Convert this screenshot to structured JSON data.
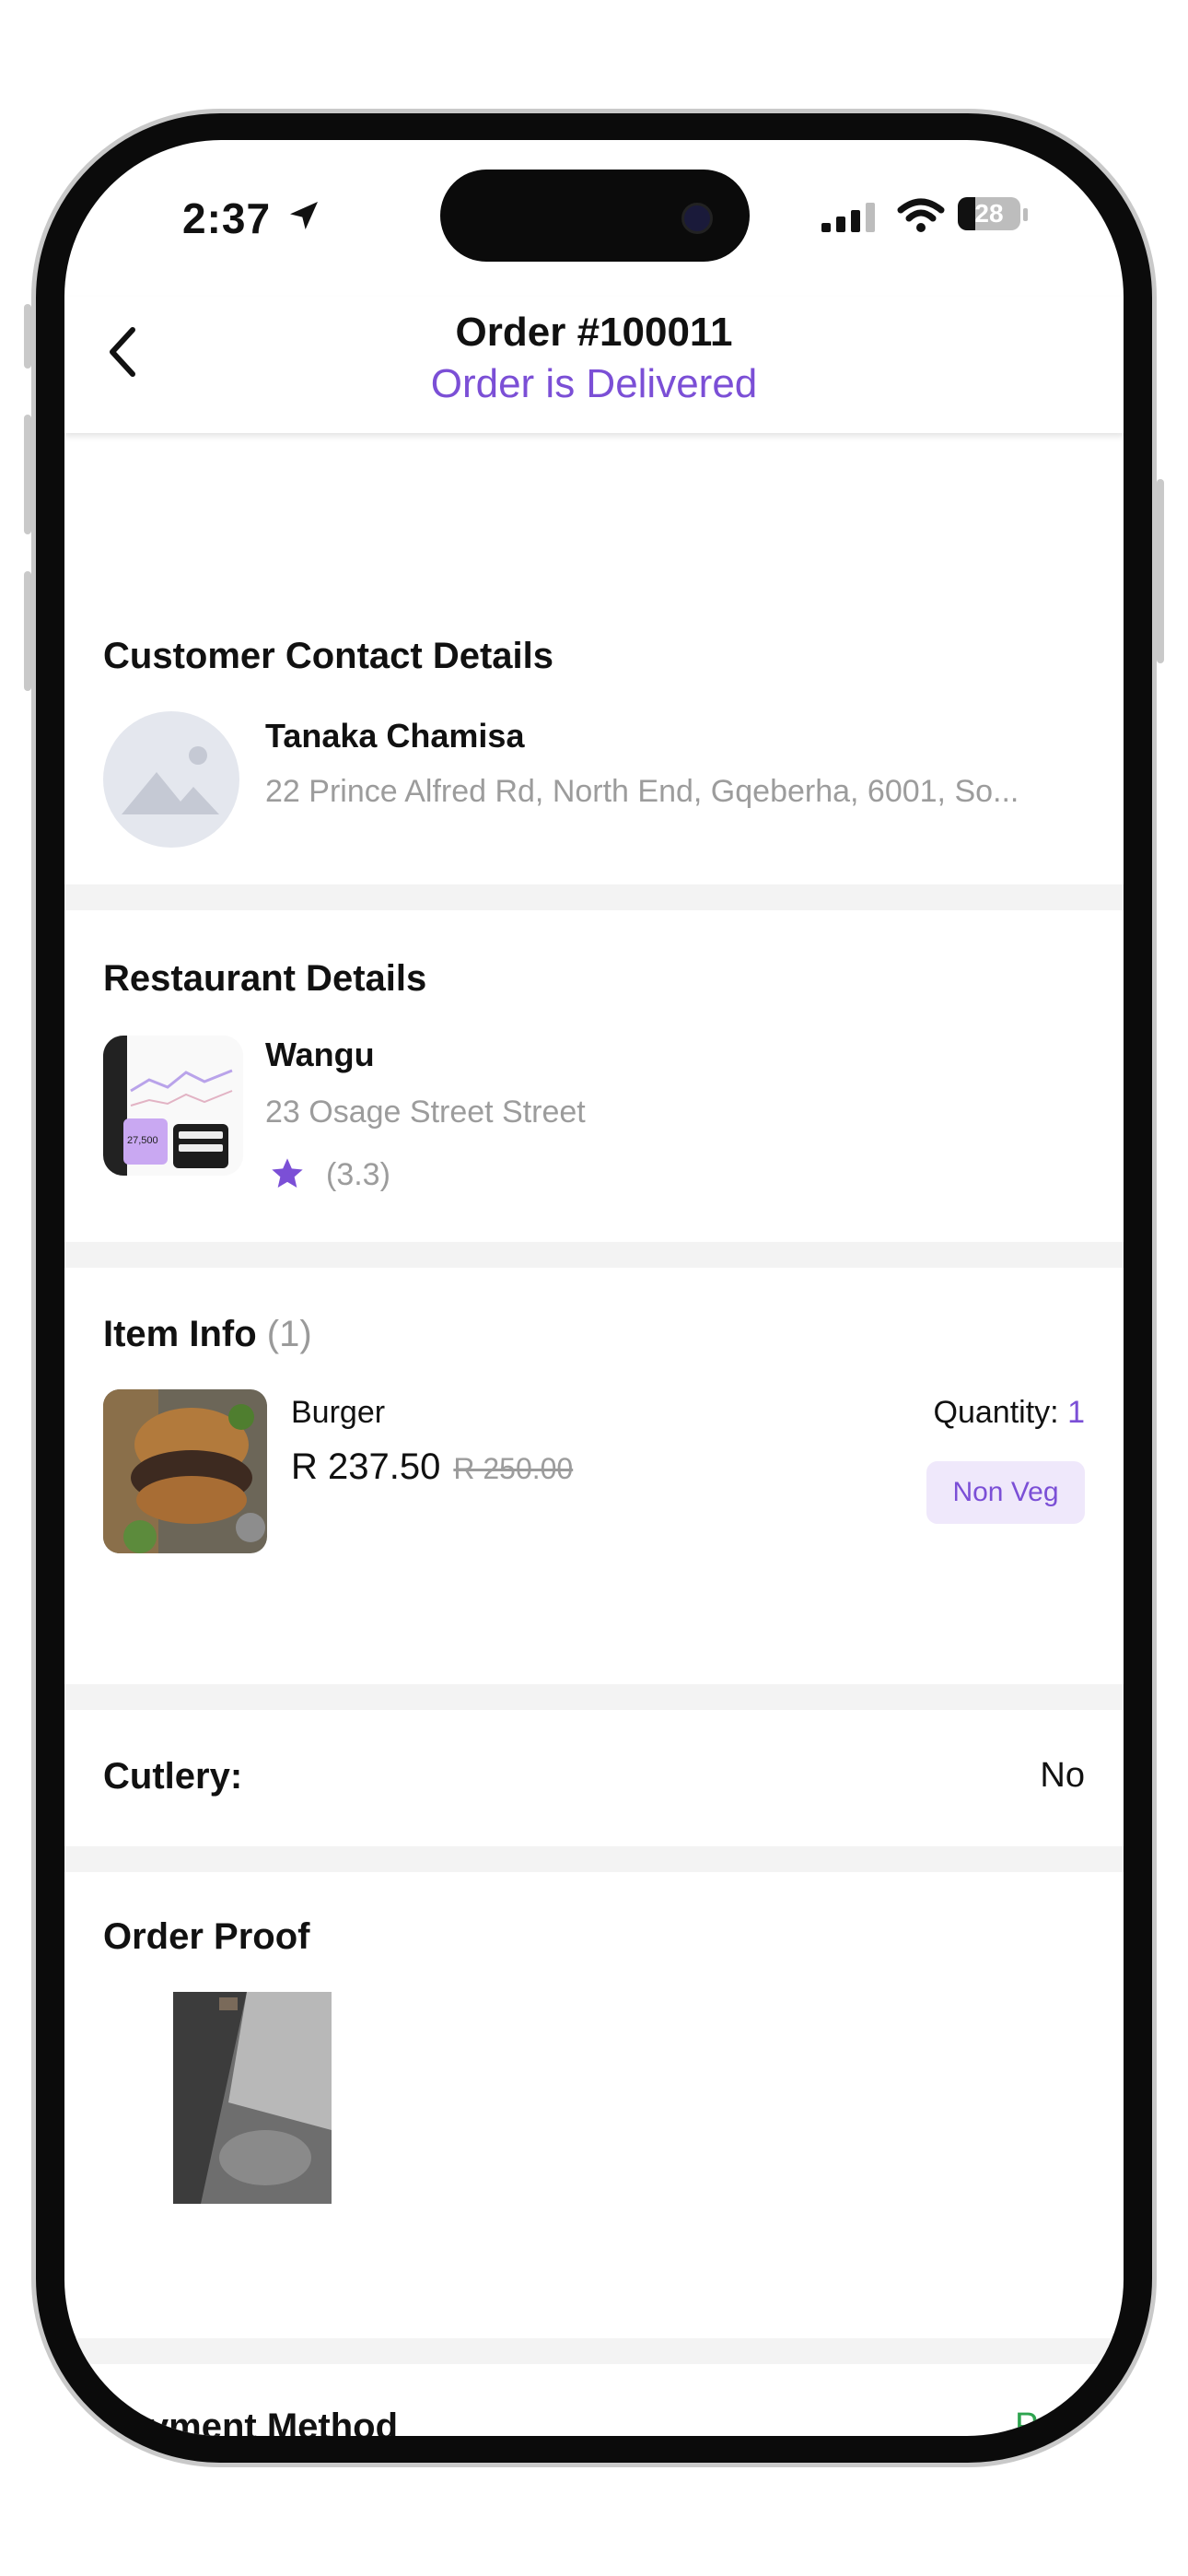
{
  "status_bar": {
    "time": "2:37",
    "battery": "28",
    "battery_level": 0.28
  },
  "header": {
    "title": "Order #100011",
    "status": "Order is Delivered"
  },
  "customer": {
    "section_title": "Customer Contact Details",
    "name": "Tanaka Chamisa",
    "address": "22 Prince Alfred Rd, North End, Gqeberha, 6001, So..."
  },
  "restaurant": {
    "section_title": "Restaurant Details",
    "name": "Wangu",
    "address": "23 Osage Street Street",
    "rating": "(3.3)",
    "thumb_value": "27,500"
  },
  "item_info": {
    "section_title": "Item Info",
    "count": "(1)",
    "items": [
      {
        "name": "Burger",
        "price": "R 237.50",
        "old_price": "R 250.00",
        "quantity_label": "Quantity:",
        "quantity": "1",
        "tag": "Non Veg"
      }
    ]
  },
  "cutlery": {
    "label": "Cutlery:",
    "value": "No"
  },
  "order_proof": {
    "label": "Order Proof"
  },
  "payment": {
    "label": "Payment Method",
    "status": "Paid"
  },
  "colors": {
    "accent": "#7b4fd6",
    "paid": "#2ea44f",
    "muted": "#9c9c9c",
    "divider": "#f3f3f3"
  },
  "icons": [
    "back-arrow-icon",
    "location-arrow-icon",
    "signal-icon",
    "wifi-icon",
    "battery-icon",
    "image-placeholder-icon",
    "star-icon"
  ]
}
